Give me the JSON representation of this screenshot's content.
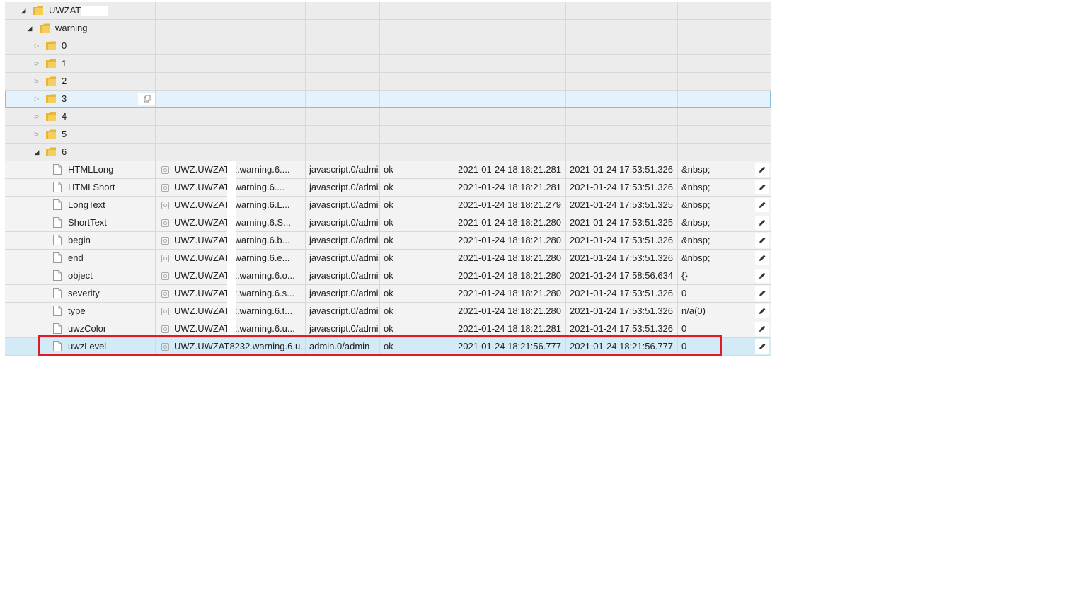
{
  "tree": {
    "root": {
      "label": "UWZAT."
    },
    "warning": {
      "label": "warning"
    },
    "folders": [
      {
        "label": "0"
      },
      {
        "label": "1"
      },
      {
        "label": "2"
      },
      {
        "label": "3"
      },
      {
        "label": "4"
      },
      {
        "label": "5"
      }
    ],
    "open_folder": {
      "label": "6"
    }
  },
  "states": [
    {
      "name": "HTMLLong",
      "id": "UWZ.UWZAT   2.warning.6....",
      "from": "javascript.0/admi",
      "q": "ok",
      "ts": "2021-01-24 18:18:21.281",
      "lc": "2021-01-24 17:53:51.326",
      "val": "&nbsp;"
    },
    {
      "name": "HTMLShort",
      "id": "UWZ.UWZAT    .warning.6....",
      "from": "javascript.0/admi",
      "q": "ok",
      "ts": "2021-01-24 18:18:21.281",
      "lc": "2021-01-24 17:53:51.326",
      "val": "&nbsp;"
    },
    {
      "name": "LongText",
      "id": "UWZ.UWZAT   .warning.6.L...",
      "from": "javascript.0/admi",
      "q": "ok",
      "ts": "2021-01-24 18:18:21.279",
      "lc": "2021-01-24 17:53:51.325",
      "val": "&nbsp;"
    },
    {
      "name": "ShortText",
      "id": "UWZ.UWZAT   .warning.6.S...",
      "from": "javascript.0/admi",
      "q": "ok",
      "ts": "2021-01-24 18:18:21.280",
      "lc": "2021-01-24 17:53:51.325",
      "val": "&nbsp;"
    },
    {
      "name": "begin",
      "id": "UWZ.UWZAT    .warning.6.b...",
      "from": "javascript.0/admi",
      "q": "ok",
      "ts": "2021-01-24 18:18:21.280",
      "lc": "2021-01-24 17:53:51.326",
      "val": "&nbsp;"
    },
    {
      "name": "end",
      "id": "UWZ.UWZAT    .warning.6.e...",
      "from": "javascript.0/admi",
      "q": "ok",
      "ts": "2021-01-24 18:18:21.280",
      "lc": "2021-01-24 17:53:51.326",
      "val": "&nbsp;"
    },
    {
      "name": "object",
      "id": "UWZ.UWZAT   2.warning.6.o...",
      "from": "javascript.0/admi",
      "q": "ok",
      "ts": "2021-01-24 18:18:21.280",
      "lc": "2021-01-24 17:58:56.634",
      "val": "{}"
    },
    {
      "name": "severity",
      "id": "UWZ.UWZAT   2.warning.6.s...",
      "from": "javascript.0/admi",
      "q": "ok",
      "ts": "2021-01-24 18:18:21.280",
      "lc": "2021-01-24 17:53:51.326",
      "val": "0"
    },
    {
      "name": "type",
      "id": "UWZ.UWZAT   2.warning.6.t...",
      "from": "javascript.0/admi",
      "q": "ok",
      "ts": "2021-01-24 18:18:21.280",
      "lc": "2021-01-24 17:53:51.326",
      "val": "n/a(0)"
    },
    {
      "name": "uwzColor",
      "id": "UWZ.UWZAT   2.warning.6.u...",
      "from": "javascript.0/admi",
      "q": "ok",
      "ts": "2021-01-24 18:18:21.281",
      "lc": "2021-01-24 17:53:51.326",
      "val": "0"
    },
    {
      "name": "uwzLevel",
      "id": "UWZ.UWZAT8232.warning.6.u...",
      "from": "admin.0/admin",
      "q": "ok",
      "ts": "2021-01-24 18:21:56.777",
      "lc": "2021-01-24 18:21:56.777",
      "val": "0"
    }
  ],
  "colors": {
    "highlight": "#e01b24",
    "selected_row": "#d3ebf7",
    "folder": "#e8b631"
  },
  "icons": {
    "folder": "folder-icon",
    "file": "file-icon",
    "edit": "pencil-icon",
    "copy": "copy-icon"
  }
}
